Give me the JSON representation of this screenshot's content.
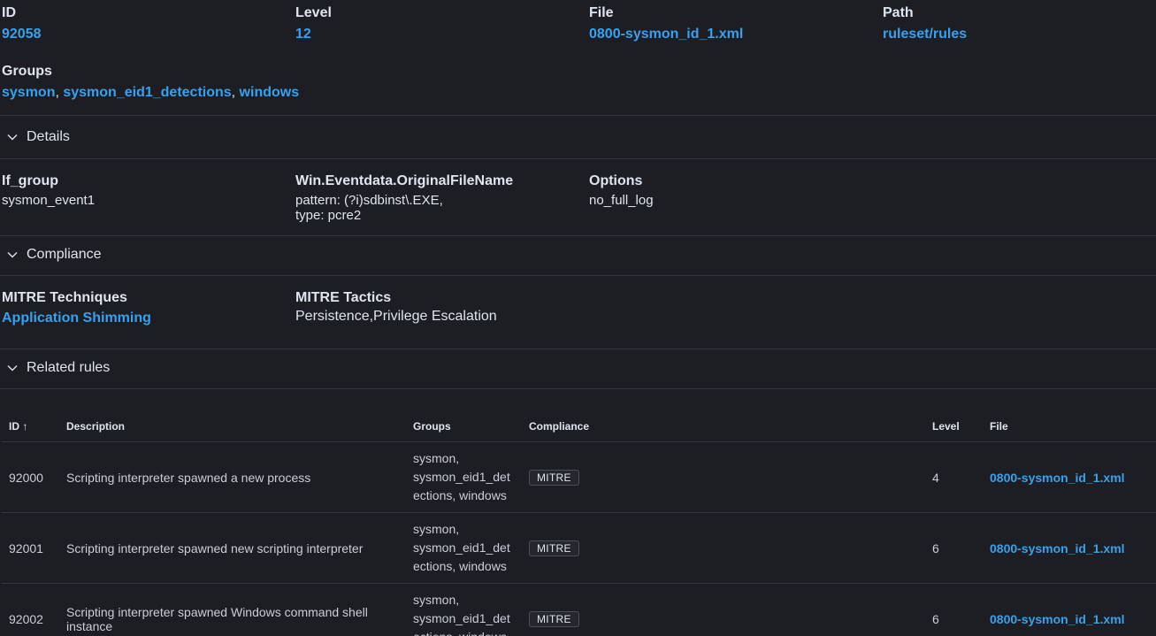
{
  "header": {
    "id_label": "ID",
    "id_value": "92058",
    "level_label": "Level",
    "level_value": "12",
    "file_label": "File",
    "file_value": "0800-sysmon_id_1.xml",
    "path_label": "Path",
    "path_value": "ruleset/rules",
    "groups_label": "Groups",
    "groups": [
      "sysmon",
      "sysmon_eid1_detections",
      "windows"
    ],
    "group_separator": ", "
  },
  "details": {
    "title": "Details",
    "if_group_label": "If_group",
    "if_group_value": "sysmon_event1",
    "field_label": "Win.Eventdata.OriginalFileName",
    "field_pattern": "pattern: (?i)sdbinst\\.EXE,",
    "field_type": "type: pcre2",
    "options_label": "Options",
    "options_value": "no_full_log"
  },
  "compliance": {
    "title": "Compliance",
    "techniques_label": "MITRE Techniques",
    "techniques_value": "Application Shimming",
    "tactics_label": "MITRE Tactics",
    "tactics_value": "Persistence,Privilege Escalation"
  },
  "related": {
    "title": "Related rules",
    "columns": {
      "id": "ID",
      "sort_icon": "↑",
      "description": "Description",
      "groups": "Groups",
      "compliance": "Compliance",
      "level": "Level",
      "file": "File"
    },
    "rows": [
      {
        "id": "92000",
        "description": "Scripting interpreter spawned a new process",
        "groups_l1": "sysmon,",
        "groups_l2": "sysmon_eid1_det",
        "groups_l3": "ections, windows",
        "badge": "MITRE",
        "level": "4",
        "file": "0800-sysmon_id_1.xml"
      },
      {
        "id": "92001",
        "description": "Scripting interpreter spawned new scripting interpreter",
        "groups_l1": "sysmon,",
        "groups_l2": "sysmon_eid1_det",
        "groups_l3": "ections, windows",
        "badge": "MITRE",
        "level": "6",
        "file": "0800-sysmon_id_1.xml"
      },
      {
        "id": "92002",
        "description": "Scripting interpreter spawned Windows command shell instance",
        "groups_l1": "sysmon,",
        "groups_l2": "sysmon_eid1_det",
        "groups_l3": "ections, windows",
        "badge": "MITRE",
        "level": "6",
        "file": "0800-sysmon_id_1.xml"
      }
    ]
  }
}
